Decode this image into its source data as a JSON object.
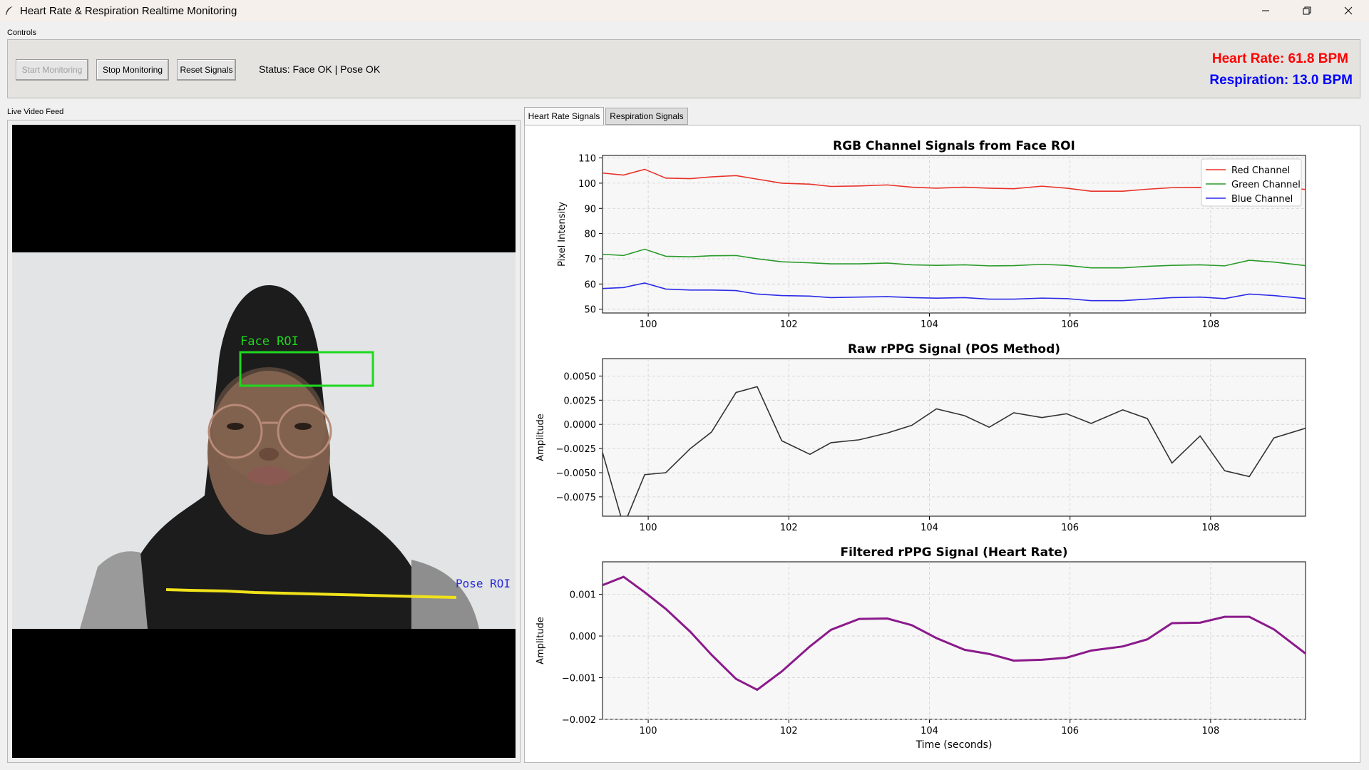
{
  "window": {
    "title": "Heart Rate & Respiration Realtime Monitoring",
    "minimize_glyph": "—",
    "restore_glyph": "❐",
    "close_glyph": "✕"
  },
  "controls": {
    "group_label": "Controls",
    "start_label": "Start Monitoring",
    "stop_label": "Stop Monitoring",
    "reset_label": "Reset Signals",
    "status_text": "Status: Face OK | Pose OK",
    "heart_rate_text": "Heart Rate: 61.8 BPM",
    "respiration_text": "Respiration: 13.0 BPM"
  },
  "video": {
    "group_label": "Live Video Feed",
    "face_roi_label": "Face ROI",
    "pose_roi_label": "Pose ROI"
  },
  "tabs": [
    {
      "label": "Heart Rate Signals",
      "active": true
    },
    {
      "label": "Respiration Signals",
      "active": false
    }
  ],
  "colors": {
    "red": "#e8322a",
    "green": "#2a9a2a",
    "blue": "#2a2ae8",
    "raw": "#333333",
    "filtered": "#8b1a8b",
    "hr_text": "#ff0000",
    "rr_text": "#0000ff"
  },
  "chart_data": [
    {
      "type": "line",
      "title": "RGB Channel Signals from Face ROI",
      "xlabel": "",
      "ylabel": "Pixel Intensity",
      "xlim": [
        99.35,
        109.35
      ],
      "ylim": [
        48.5,
        111
      ],
      "xticks": [
        100,
        102,
        104,
        106,
        108
      ],
      "yticks": [
        50,
        60,
        70,
        80,
        90,
        100,
        110
      ],
      "grid": true,
      "legend": "top-right",
      "x": [
        99.35,
        99.65,
        99.95,
        100.25,
        100.6,
        100.9,
        101.25,
        101.55,
        101.9,
        102.3,
        102.6,
        103.0,
        103.4,
        103.75,
        104.1,
        104.5,
        104.85,
        105.2,
        105.6,
        105.95,
        106.3,
        106.75,
        107.1,
        107.45,
        107.85,
        108.2,
        108.55,
        108.9,
        109.35
      ],
      "series": [
        {
          "name": "Red Channel",
          "color": "#e8322a",
          "values": [
            104.0,
            103.2,
            105.5,
            102.0,
            101.8,
            102.5,
            103.0,
            101.6,
            100.0,
            99.6,
            98.7,
            98.9,
            99.3,
            98.4,
            98.0,
            98.4,
            98.0,
            97.8,
            98.8,
            98.0,
            96.8,
            96.8,
            97.6,
            98.2,
            98.3,
            98.1,
            98.4,
            98.5,
            97.5
          ]
        },
        {
          "name": "Green Channel",
          "color": "#2a9a2a",
          "values": [
            71.8,
            71.3,
            73.8,
            71.0,
            70.8,
            71.2,
            71.3,
            70.0,
            68.8,
            68.4,
            68.0,
            68.0,
            68.3,
            67.6,
            67.4,
            67.6,
            67.2,
            67.3,
            67.8,
            67.4,
            66.4,
            66.4,
            67.0,
            67.4,
            67.6,
            67.2,
            69.4,
            68.7,
            67.3
          ]
        },
        {
          "name": "Blue Channel",
          "color": "#2a2ae8",
          "values": [
            58.2,
            58.6,
            60.4,
            58.0,
            57.6,
            57.6,
            57.4,
            56.0,
            55.4,
            55.2,
            54.6,
            54.8,
            55.0,
            54.6,
            54.4,
            54.6,
            54.0,
            54.0,
            54.4,
            54.2,
            53.4,
            53.4,
            54.0,
            54.6,
            54.8,
            54.2,
            56.0,
            55.4,
            54.2
          ]
        }
      ]
    },
    {
      "type": "line",
      "title": "Raw rPPG Signal (POS Method)",
      "xlabel": "",
      "ylabel": "Amplitude",
      "xlim": [
        99.35,
        109.35
      ],
      "ylim": [
        -0.0095,
        0.0068
      ],
      "xticks": [
        100,
        102,
        104,
        106,
        108
      ],
      "yticks": [
        -0.0075,
        -0.005,
        -0.0025,
        0.0,
        0.0025,
        0.005
      ],
      "ytick_labels": [
        "−0.0075",
        "−0.0050",
        "−0.0025",
        "0.0000",
        "0.0025",
        "0.0050"
      ],
      "grid": true,
      "x": [
        99.35,
        99.65,
        99.95,
        100.25,
        100.6,
        100.9,
        101.25,
        101.55,
        101.9,
        102.3,
        102.6,
        103.0,
        103.4,
        103.75,
        104.1,
        104.5,
        104.85,
        105.2,
        105.6,
        105.95,
        106.3,
        106.75,
        107.1,
        107.45,
        107.85,
        108.2,
        108.55,
        108.9,
        109.35
      ],
      "series": [
        {
          "name": "",
          "color": "#333333",
          "values": [
            -0.0029,
            -0.0105,
            -0.0052,
            -0.005,
            -0.0025,
            -0.0008,
            0.0033,
            0.0039,
            -0.0017,
            -0.0031,
            -0.0019,
            -0.0016,
            -0.0009,
            -0.0001,
            0.0016,
            0.0009,
            -0.0003,
            0.0012,
            0.0007,
            0.0011,
            0.0001,
            0.0015,
            0.0006,
            -0.004,
            -0.0012,
            -0.0048,
            -0.0054,
            -0.0014,
            -0.0004
          ]
        }
      ]
    },
    {
      "type": "line",
      "title": "Filtered rPPG Signal (Heart Rate)",
      "xlabel": "Time (seconds)",
      "ylabel": "Amplitude",
      "xlim": [
        99.35,
        109.35
      ],
      "ylim": [
        -0.002,
        0.00178
      ],
      "xticks": [
        100,
        102,
        104,
        106,
        108
      ],
      "yticks": [
        -0.002,
        -0.001,
        0.0,
        0.001
      ],
      "ytick_labels": [
        "−0.002",
        "−0.001",
        "0.000",
        "0.001"
      ],
      "grid": true,
      "x": [
        99.35,
        99.65,
        99.95,
        100.25,
        100.6,
        100.9,
        101.25,
        101.55,
        101.9,
        102.3,
        102.6,
        103.0,
        103.4,
        103.75,
        104.1,
        104.5,
        104.85,
        105.2,
        105.6,
        105.95,
        106.3,
        106.75,
        107.1,
        107.45,
        107.85,
        108.2,
        108.55,
        108.9,
        109.35
      ],
      "series": [
        {
          "name": "",
          "color": "#8b1a8b",
          "values": [
            0.00122,
            0.00142,
            0.00105,
            0.00065,
            0.0001,
            -0.00045,
            -0.00103,
            -0.00129,
            -0.00085,
            -0.00025,
            0.00015,
            0.00041,
            0.00042,
            0.00026,
            -5e-05,
            -0.00033,
            -0.00043,
            -0.00059,
            -0.00057,
            -0.00052,
            -0.00035,
            -0.00025,
            -8e-05,
            0.00031,
            0.00032,
            0.00046,
            0.00046,
            0.00016,
            -0.00042,
            -0.00064
          ]
        }
      ]
    }
  ]
}
